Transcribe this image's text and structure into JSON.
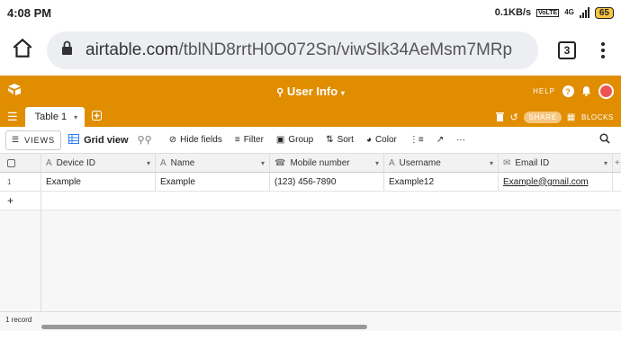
{
  "status_bar": {
    "time": "4:08 PM",
    "speed": "0.1KB/s",
    "net_top": "4G",
    "battery": "65"
  },
  "browser": {
    "url_host": "airtable.com",
    "url_path": "/tblND8rrtH0O072Sn/viwSlk34AeMsm7MRp",
    "tab_count": "3"
  },
  "base": {
    "title": "User Info",
    "help": "HELP",
    "share": "SHARE",
    "blocks": "BLOCKS"
  },
  "tabs": {
    "table1": "Table 1"
  },
  "toolbar": {
    "views": "VIEWS",
    "view_name": "Grid view",
    "hide_fields": "Hide fields",
    "filter": "Filter",
    "group": "Group",
    "sort": "Sort",
    "color": "Color",
    "more": "···"
  },
  "columns": [
    "Device ID",
    "Name",
    "Mobile number",
    "Username",
    "Email ID"
  ],
  "rows": [
    {
      "num": "1",
      "device_id": "Example",
      "name": "Example",
      "mobile": "(123) 456-7890",
      "username": "Example12",
      "email": "Example@gmail.com"
    }
  ],
  "footer": {
    "record_count": "1 record"
  },
  "colors": {
    "brand": "#e08d00",
    "share_bg": "#f6c67f"
  }
}
